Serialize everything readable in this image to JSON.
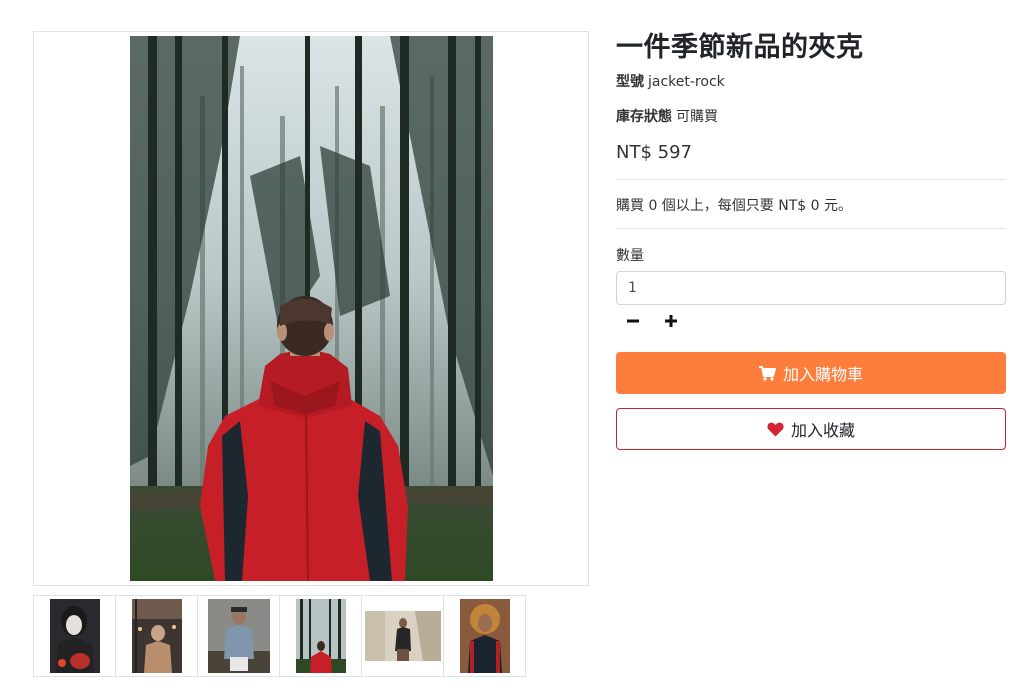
{
  "product": {
    "title": "一件季節新品的夾克",
    "sku_label": "型號",
    "sku_value": "jacket-rock",
    "stock_label": "庫存狀態",
    "stock_value": "可購買",
    "price": "NT$ 597",
    "bulk_note": "購買 0 個以上，每個只要 NT$ 0 元。"
  },
  "quantity": {
    "label": "數量",
    "value": "1",
    "minus_icon": "minus-icon",
    "plus_icon": "plus-icon"
  },
  "actions": {
    "add_to_cart": "加入購物車",
    "add_to_cart_icon": "cart-icon",
    "add_to_favorites": "加入收藏",
    "add_to_favorites_icon": "heart-icon"
  },
  "gallery": {
    "main_image": "man in red jacket standing in forest, back view",
    "thumbnails": [
      "person in hoodie with mask and red light",
      "woman in coat on street",
      "man in denim jacket and cap",
      "man in red jacket in forest",
      "man leaning on wall",
      "woman with curly hair in jacket"
    ]
  },
  "colors": {
    "accent_orange": "#fd7e3c",
    "danger_red": "#c82333",
    "border": "#dee2e6"
  }
}
